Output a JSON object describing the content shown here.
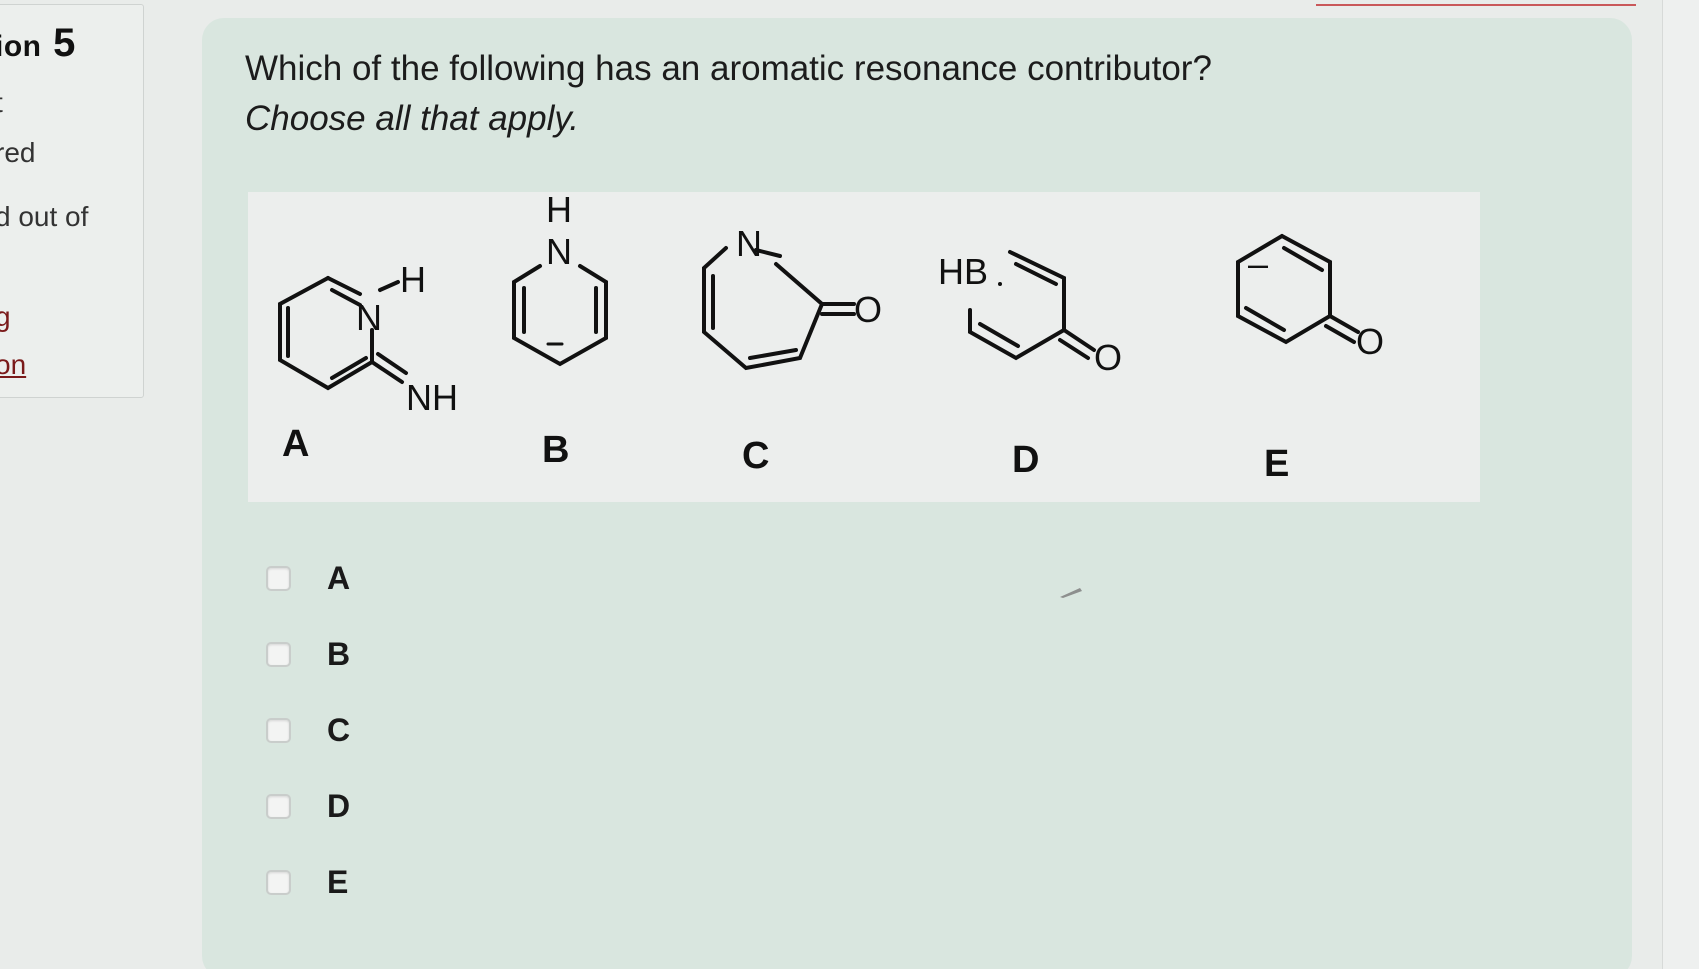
{
  "sidebar": {
    "question_title": "ion",
    "question_number": "5",
    "line1": "t",
    "line2": "red",
    "line3": "d out of",
    "line4": "g",
    "link": "on"
  },
  "question": {
    "prompt": "Which of the following has an aromatic resonance contributor?",
    "instruction": "Choose all that apply."
  },
  "structures": [
    {
      "label": "A",
      "atoms": [
        "N",
        "H",
        "NH"
      ]
    },
    {
      "label": "B",
      "atoms": [
        "H",
        "N",
        "–"
      ]
    },
    {
      "label": "C",
      "atoms": [
        "N",
        "O"
      ]
    },
    {
      "label": "D",
      "atoms": [
        "HB",
        "O"
      ]
    },
    {
      "label": "E",
      "atoms": [
        "–",
        "O"
      ]
    }
  ],
  "options": [
    {
      "label": "A",
      "checked": false
    },
    {
      "label": "B",
      "checked": false
    },
    {
      "label": "C",
      "checked": false
    },
    {
      "label": "D",
      "checked": false
    },
    {
      "label": "E",
      "checked": false
    }
  ]
}
